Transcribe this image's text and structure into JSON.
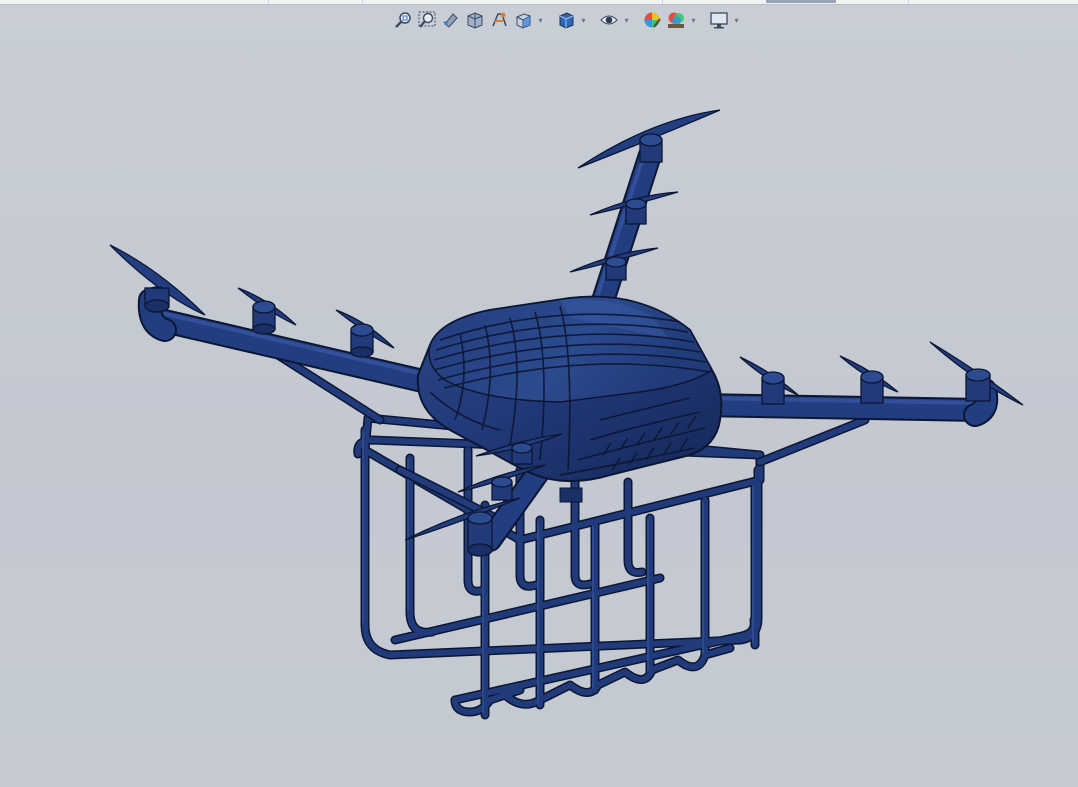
{
  "app": {
    "title": ""
  },
  "heads_up_toolbar": {
    "items": [
      {
        "icon": "zoom-to-fit-icon",
        "name": "zoom-to-fit"
      },
      {
        "icon": "zoom-to-area-icon",
        "name": "zoom-to-area"
      },
      {
        "icon": "previous-view-icon",
        "name": "previous-view"
      },
      {
        "icon": "section-view-icon",
        "name": "section-view"
      },
      {
        "icon": "dynamic-annotation-icon",
        "name": "dynamic-annotation-views"
      },
      {
        "icon": "view-orientation-icon",
        "name": "view-orientation",
        "dropdown": true
      },
      {
        "icon": "display-style-icon",
        "name": "display-style",
        "dropdown": true
      },
      {
        "icon": "hide-show-items-icon",
        "name": "hide-show-items",
        "dropdown": true
      },
      {
        "icon": "edit-appearance-icon",
        "name": "edit-appearance"
      },
      {
        "icon": "apply-scene-icon",
        "name": "apply-scene",
        "dropdown": true
      },
      {
        "icon": "view-settings-icon",
        "name": "view-settings",
        "dropdown": true
      }
    ]
  },
  "colors": {
    "background": "#c5cad3",
    "model_fill": "#1d3470",
    "model_edge": "#0b1632"
  },
  "model": {
    "description_visible": false
  }
}
